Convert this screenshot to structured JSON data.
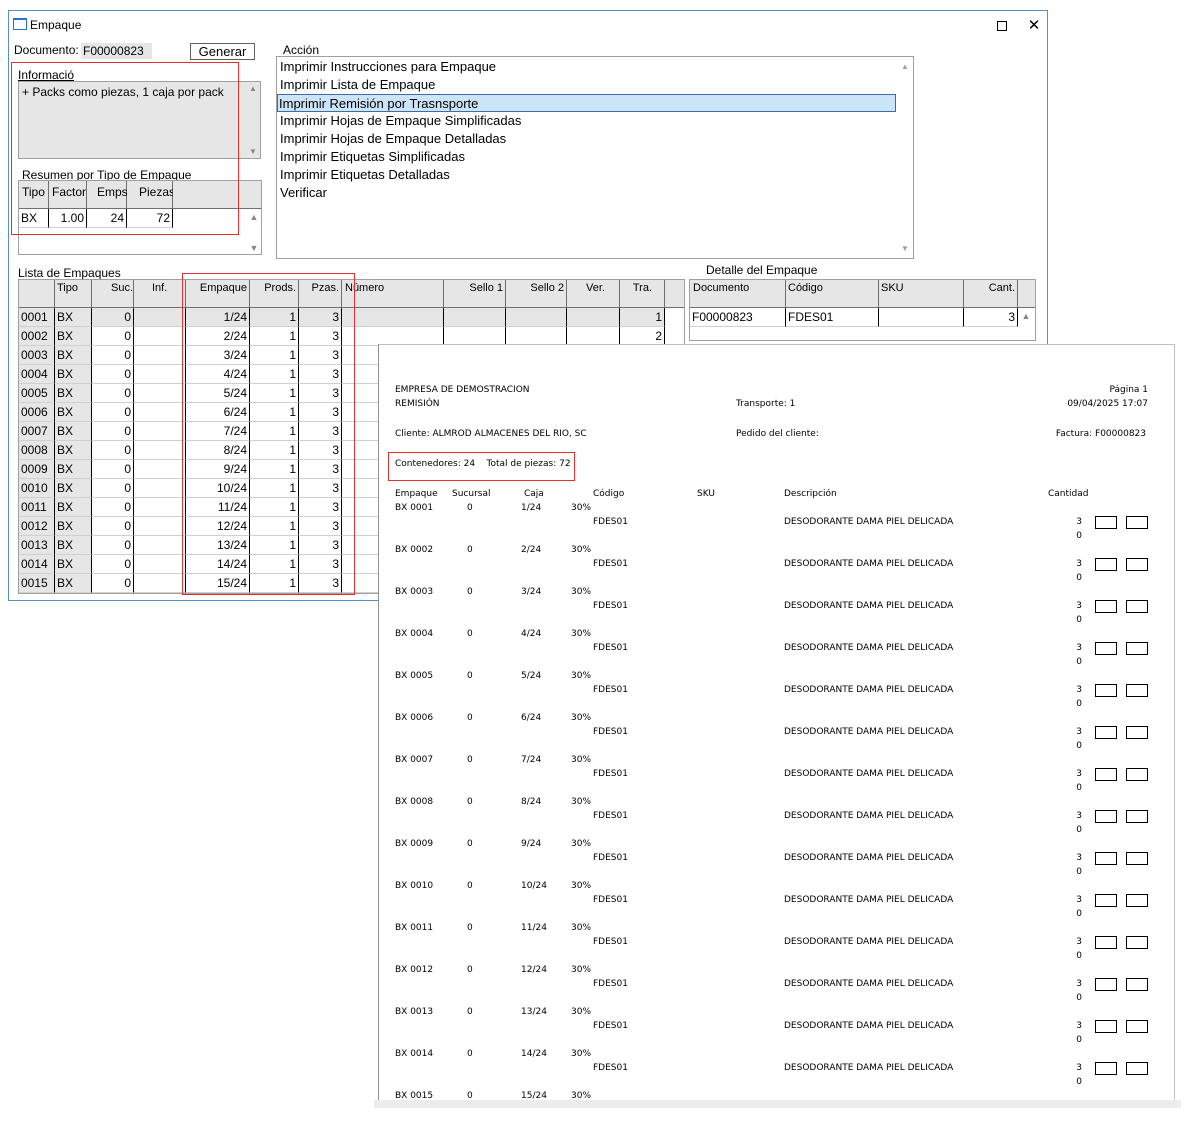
{
  "window": {
    "title": "Empaque",
    "document_label": "Documento:",
    "document_value": "F00000823",
    "generate_label": "Generar",
    "action_label": "Acción",
    "info_label": "Informació",
    "info_text": "+ Packs como piezas, 1 caja por pack",
    "summary_label": "Resumen por Tipo de Empaque",
    "list_label": "Lista de Empaques",
    "detail_label": "Detalle del Empaque",
    "maximize_icon": "maximize-icon",
    "close_icon": "close-icon",
    "close_glyph": "✕"
  },
  "actions": [
    "Imprimir Instrucciones para Empaque",
    "Imprimir Lista de Empaque",
    "Imprimir Remisión por Trasnsporte",
    "Imprimir Hojas de Empaque Simplificadas",
    "Imprimir Hojas de Empaque Detalladas",
    "Imprimir Etiquetas Simplificadas",
    "Imprimir Etiquetas Detalladas",
    "Verificar"
  ],
  "selected_action": 2,
  "summary": {
    "headers": [
      "Tipo",
      "Factor",
      "Emps",
      "Piezas"
    ],
    "rows": [
      [
        "BX",
        "1.00",
        "24",
        "72"
      ]
    ]
  },
  "packages": {
    "headers": [
      "Tipo",
      "Suc.",
      "Inf.",
      "Empaque",
      "Prods.",
      "Pzas.",
      "Número",
      "Sello 1",
      "Sello 2",
      "Ver.",
      "Tra."
    ],
    "rows": [
      {
        "id": "0001",
        "tipo": "BX",
        "suc": "0",
        "empaque": "1/24",
        "prods": "1",
        "pzas": "3",
        "tra": "1"
      },
      {
        "id": "0002",
        "tipo": "BX",
        "suc": "0",
        "empaque": "2/24",
        "prods": "1",
        "pzas": "3",
        "tra": "2"
      },
      {
        "id": "0003",
        "tipo": "BX",
        "suc": "0",
        "empaque": "3/24",
        "prods": "1",
        "pzas": "3",
        "tra": ""
      },
      {
        "id": "0004",
        "tipo": "BX",
        "suc": "0",
        "empaque": "4/24",
        "prods": "1",
        "pzas": "3",
        "tra": ""
      },
      {
        "id": "0005",
        "tipo": "BX",
        "suc": "0",
        "empaque": "5/24",
        "prods": "1",
        "pzas": "3",
        "tra": ""
      },
      {
        "id": "0006",
        "tipo": "BX",
        "suc": "0",
        "empaque": "6/24",
        "prods": "1",
        "pzas": "3",
        "tra": ""
      },
      {
        "id": "0007",
        "tipo": "BX",
        "suc": "0",
        "empaque": "7/24",
        "prods": "1",
        "pzas": "3",
        "tra": ""
      },
      {
        "id": "0008",
        "tipo": "BX",
        "suc": "0",
        "empaque": "8/24",
        "prods": "1",
        "pzas": "3",
        "tra": ""
      },
      {
        "id": "0009",
        "tipo": "BX",
        "suc": "0",
        "empaque": "9/24",
        "prods": "1",
        "pzas": "3",
        "tra": ""
      },
      {
        "id": "0010",
        "tipo": "BX",
        "suc": "0",
        "empaque": "10/24",
        "prods": "1",
        "pzas": "3",
        "tra": ""
      },
      {
        "id": "0011",
        "tipo": "BX",
        "suc": "0",
        "empaque": "11/24",
        "prods": "1",
        "pzas": "3",
        "tra": ""
      },
      {
        "id": "0012",
        "tipo": "BX",
        "suc": "0",
        "empaque": "12/24",
        "prods": "1",
        "pzas": "3",
        "tra": ""
      },
      {
        "id": "0013",
        "tipo": "BX",
        "suc": "0",
        "empaque": "13/24",
        "prods": "1",
        "pzas": "3",
        "tra": ""
      },
      {
        "id": "0014",
        "tipo": "BX",
        "suc": "0",
        "empaque": "14/24",
        "prods": "1",
        "pzas": "3",
        "tra": ""
      },
      {
        "id": "0015",
        "tipo": "BX",
        "suc": "0",
        "empaque": "15/24",
        "prods": "1",
        "pzas": "3",
        "tra": ""
      }
    ]
  },
  "detail": {
    "headers": [
      "Documento",
      "Código",
      "SKU",
      "Cant."
    ],
    "rows": [
      [
        "F00000823",
        "FDES01",
        "",
        "3"
      ]
    ]
  },
  "report": {
    "company": "EMPRESA DE DEMOSTRACION",
    "doc_type": "REMISIÓN",
    "transport": "Transporte: 1",
    "page": "Página 1",
    "datetime": "09/04/2025 17:07",
    "client": "Cliente: ALMROD ALMACENES DEL RIO, SC",
    "order": "Pedido del cliente:",
    "invoice": "Factura: F00000823",
    "totals": "Contenedores: 24    Total de piezas: 72",
    "headers": [
      "Empaque",
      "Sucursal",
      "Caja",
      "Código",
      "SKU",
      "Descripción",
      "Cantidad"
    ],
    "rows": [
      {
        "emp": "BX 0001",
        "suc": "0",
        "caja": "1/24",
        "pct": "30%",
        "code": "FDES01",
        "desc": "DESODORANTE DAMA PIEL DELICADA",
        "qty": "3",
        "sub": "0"
      },
      {
        "emp": "BX 0002",
        "suc": "0",
        "caja": "2/24",
        "pct": "30%",
        "code": "FDES01",
        "desc": "DESODORANTE DAMA PIEL DELICADA",
        "qty": "3",
        "sub": "0"
      },
      {
        "emp": "BX 0003",
        "suc": "0",
        "caja": "3/24",
        "pct": "30%",
        "code": "FDES01",
        "desc": "DESODORANTE DAMA PIEL DELICADA",
        "qty": "3",
        "sub": "0"
      },
      {
        "emp": "BX 0004",
        "suc": "0",
        "caja": "4/24",
        "pct": "30%",
        "code": "FDES01",
        "desc": "DESODORANTE DAMA PIEL DELICADA",
        "qty": "3",
        "sub": "0"
      },
      {
        "emp": "BX 0005",
        "suc": "0",
        "caja": "5/24",
        "pct": "30%",
        "code": "FDES01",
        "desc": "DESODORANTE DAMA PIEL DELICADA",
        "qty": "3",
        "sub": "0"
      },
      {
        "emp": "BX 0006",
        "suc": "0",
        "caja": "6/24",
        "pct": "30%",
        "code": "FDES01",
        "desc": "DESODORANTE DAMA PIEL DELICADA",
        "qty": "3",
        "sub": "0"
      },
      {
        "emp": "BX 0007",
        "suc": "0",
        "caja": "7/24",
        "pct": "30%",
        "code": "FDES01",
        "desc": "DESODORANTE DAMA PIEL DELICADA",
        "qty": "3",
        "sub": "0"
      },
      {
        "emp": "BX 0008",
        "suc": "0",
        "caja": "8/24",
        "pct": "30%",
        "code": "FDES01",
        "desc": "DESODORANTE DAMA PIEL DELICADA",
        "qty": "3",
        "sub": "0"
      },
      {
        "emp": "BX 0009",
        "suc": "0",
        "caja": "9/24",
        "pct": "30%",
        "code": "FDES01",
        "desc": "DESODORANTE DAMA PIEL DELICADA",
        "qty": "3",
        "sub": "0"
      },
      {
        "emp": "BX 0010",
        "suc": "0",
        "caja": "10/24",
        "pct": "30%",
        "code": "FDES01",
        "desc": "DESODORANTE DAMA PIEL DELICADA",
        "qty": "3",
        "sub": "0"
      },
      {
        "emp": "BX 0011",
        "suc": "0",
        "caja": "11/24",
        "pct": "30%",
        "code": "FDES01",
        "desc": "DESODORANTE DAMA PIEL DELICADA",
        "qty": "3",
        "sub": "0"
      },
      {
        "emp": "BX 0012",
        "suc": "0",
        "caja": "12/24",
        "pct": "30%",
        "code": "FDES01",
        "desc": "DESODORANTE DAMA PIEL DELICADA",
        "qty": "3",
        "sub": "0"
      },
      {
        "emp": "BX 0013",
        "suc": "0",
        "caja": "13/24",
        "pct": "30%",
        "code": "FDES01",
        "desc": "DESODORANTE DAMA PIEL DELICADA",
        "qty": "3",
        "sub": "0"
      },
      {
        "emp": "BX 0014",
        "suc": "0",
        "caja": "14/24",
        "pct": "30%",
        "code": "FDES01",
        "desc": "DESODORANTE DAMA PIEL DELICADA",
        "qty": "3",
        "sub": "0"
      },
      {
        "emp": "BX 0015",
        "suc": "0",
        "caja": "15/24",
        "pct": "30%",
        "code": "",
        "desc": "",
        "qty": "",
        "sub": ""
      }
    ]
  },
  "colors": {
    "selection": "#cce4f7",
    "selection_border": "#3c6ea5",
    "annotation": "#e03030",
    "window_border": "#5b8fc7",
    "cell_gray": "#e6e6e6"
  }
}
